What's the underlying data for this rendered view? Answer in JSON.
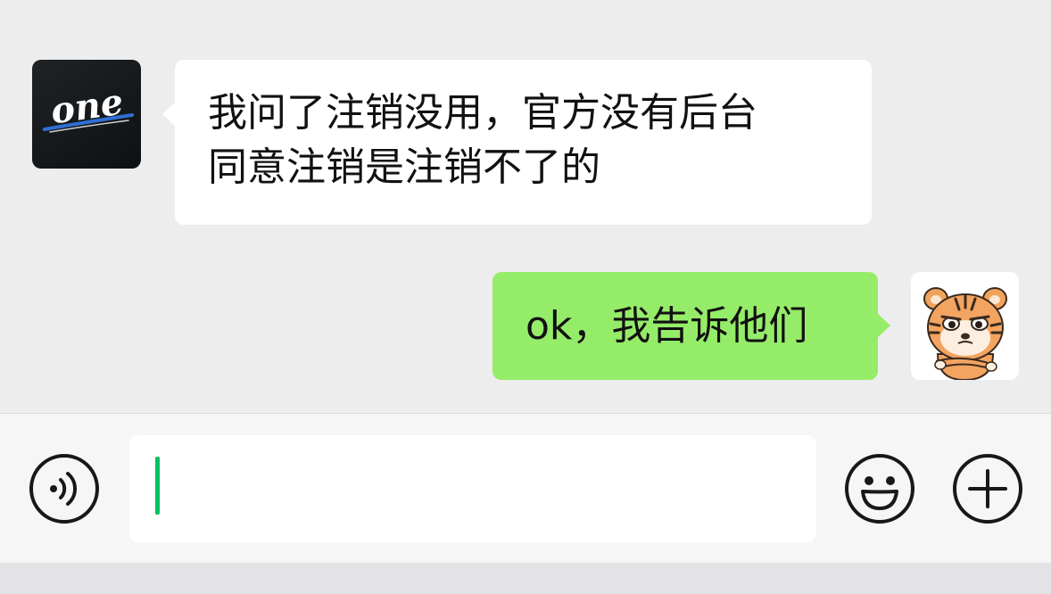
{
  "conversation": {
    "messages": [
      {
        "side": "left",
        "avatar_icon": "one-app-logo",
        "avatar_text": "one",
        "lines": [
          "我问了注销没用，官方没有后台",
          "同意注销是注销不了的"
        ]
      },
      {
        "side": "right",
        "avatar_icon": "tiger-sticker-avatar",
        "text": "ok，我告诉他们"
      }
    ]
  },
  "input_bar": {
    "voice_icon": "voice-icon",
    "input_value": "",
    "emoji_icon": "emoji-icon",
    "plus_icon": "plus-icon"
  },
  "colors": {
    "background": "#ededed",
    "incoming_bubble": "#ffffff",
    "outgoing_bubble": "#95ec69",
    "caret": "#07c160",
    "icon_stroke": "#181818"
  }
}
